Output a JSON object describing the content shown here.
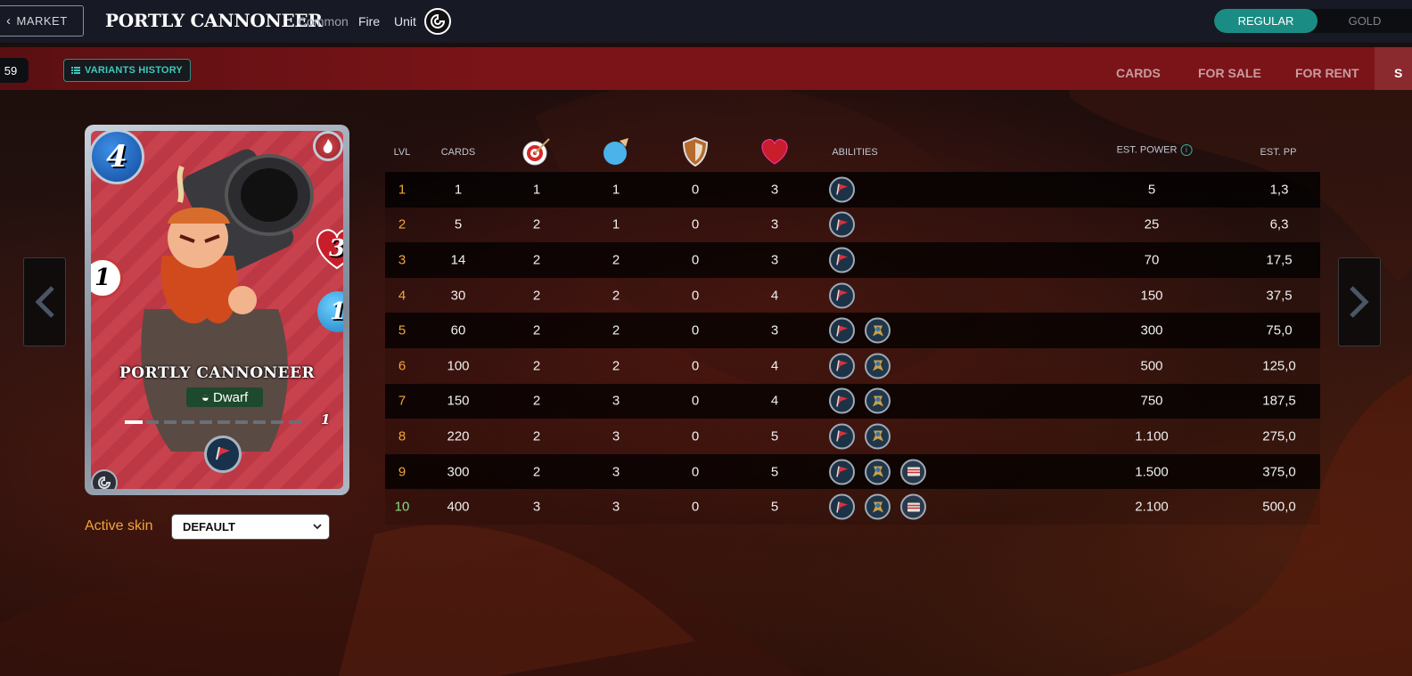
{
  "header": {
    "back_label": "MARKET",
    "card_name": "PORTLY CANNONEER",
    "rarity": "Common",
    "element": "Fire",
    "type": "Unit",
    "foil_toggle": {
      "options": [
        "REGULAR",
        "GOLD"
      ],
      "selected": "REGULAR"
    }
  },
  "subbar": {
    "count": "59",
    "variants_label": "VARIANTS HISTORY",
    "tabs": [
      "CARDS",
      "FOR SALE",
      "FOR RENT",
      "S"
    ]
  },
  "card": {
    "name": "PORTLY CANNONEER",
    "race": "Dwarf",
    "mana": "4",
    "health": "3",
    "ranged": "1",
    "speed": "1",
    "level": "1",
    "level_progress": 0.1
  },
  "skin": {
    "label": "Active skin",
    "selected": "DEFAULT"
  },
  "table": {
    "headers": {
      "lvl": "LVL",
      "cards": "CARDS",
      "ranged_icon": "ranged-attack-icon",
      "speed_icon": "speed-icon",
      "armor_icon": "armor-icon",
      "health_icon": "health-icon",
      "abilities": "ABILITIES",
      "est_power": "EST. POWER",
      "est_pp": "EST. PP"
    },
    "rows": [
      {
        "lvl": "1",
        "cards": "1",
        "ranged": "1",
        "speed": "1",
        "armor": "0",
        "health": "3",
        "abilities": [
          "flag-icon"
        ],
        "power": "5",
        "pp": "1,3"
      },
      {
        "lvl": "2",
        "cards": "5",
        "ranged": "2",
        "speed": "1",
        "armor": "0",
        "health": "3",
        "abilities": [
          "flag-icon"
        ],
        "power": "25",
        "pp": "6,3"
      },
      {
        "lvl": "3",
        "cards": "14",
        "ranged": "2",
        "speed": "2",
        "armor": "0",
        "health": "3",
        "abilities": [
          "flag-icon"
        ],
        "power": "70",
        "pp": "17,5"
      },
      {
        "lvl": "4",
        "cards": "30",
        "ranged": "2",
        "speed": "2",
        "armor": "0",
        "health": "4",
        "abilities": [
          "flag-icon"
        ],
        "power": "150",
        "pp": "37,5"
      },
      {
        "lvl": "5",
        "cards": "60",
        "ranged": "2",
        "speed": "2",
        "armor": "0",
        "health": "3",
        "abilities": [
          "flag-icon",
          "dwarf-icon"
        ],
        "power": "300",
        "pp": "75,0"
      },
      {
        "lvl": "6",
        "cards": "100",
        "ranged": "2",
        "speed": "2",
        "armor": "0",
        "health": "4",
        "abilities": [
          "flag-icon",
          "dwarf-icon"
        ],
        "power": "500",
        "pp": "125,0"
      },
      {
        "lvl": "7",
        "cards": "150",
        "ranged": "2",
        "speed": "3",
        "armor": "0",
        "health": "4",
        "abilities": [
          "flag-icon",
          "dwarf-icon"
        ],
        "power": "750",
        "pp": "187,5"
      },
      {
        "lvl": "8",
        "cards": "220",
        "ranged": "2",
        "speed": "3",
        "armor": "0",
        "health": "5",
        "abilities": [
          "flag-icon",
          "dwarf-icon"
        ],
        "power": "1.100",
        "pp": "275,0"
      },
      {
        "lvl": "9",
        "cards": "300",
        "ranged": "2",
        "speed": "3",
        "armor": "0",
        "health": "5",
        "abilities": [
          "flag-icon",
          "dwarf-icon",
          "book-icon"
        ],
        "power": "1.500",
        "pp": "375,0"
      },
      {
        "lvl": "10",
        "cards": "400",
        "ranged": "3",
        "speed": "3",
        "armor": "0",
        "health": "5",
        "abilities": [
          "flag-icon",
          "dwarf-icon",
          "book-icon"
        ],
        "power": "2.100",
        "pp": "500,0"
      }
    ]
  },
  "colors": {
    "accent_teal": "#1b8c84",
    "level_orange": "#f2a53b",
    "max_level_green": "#7fe07f",
    "subbar_red": "#7a1418"
  }
}
